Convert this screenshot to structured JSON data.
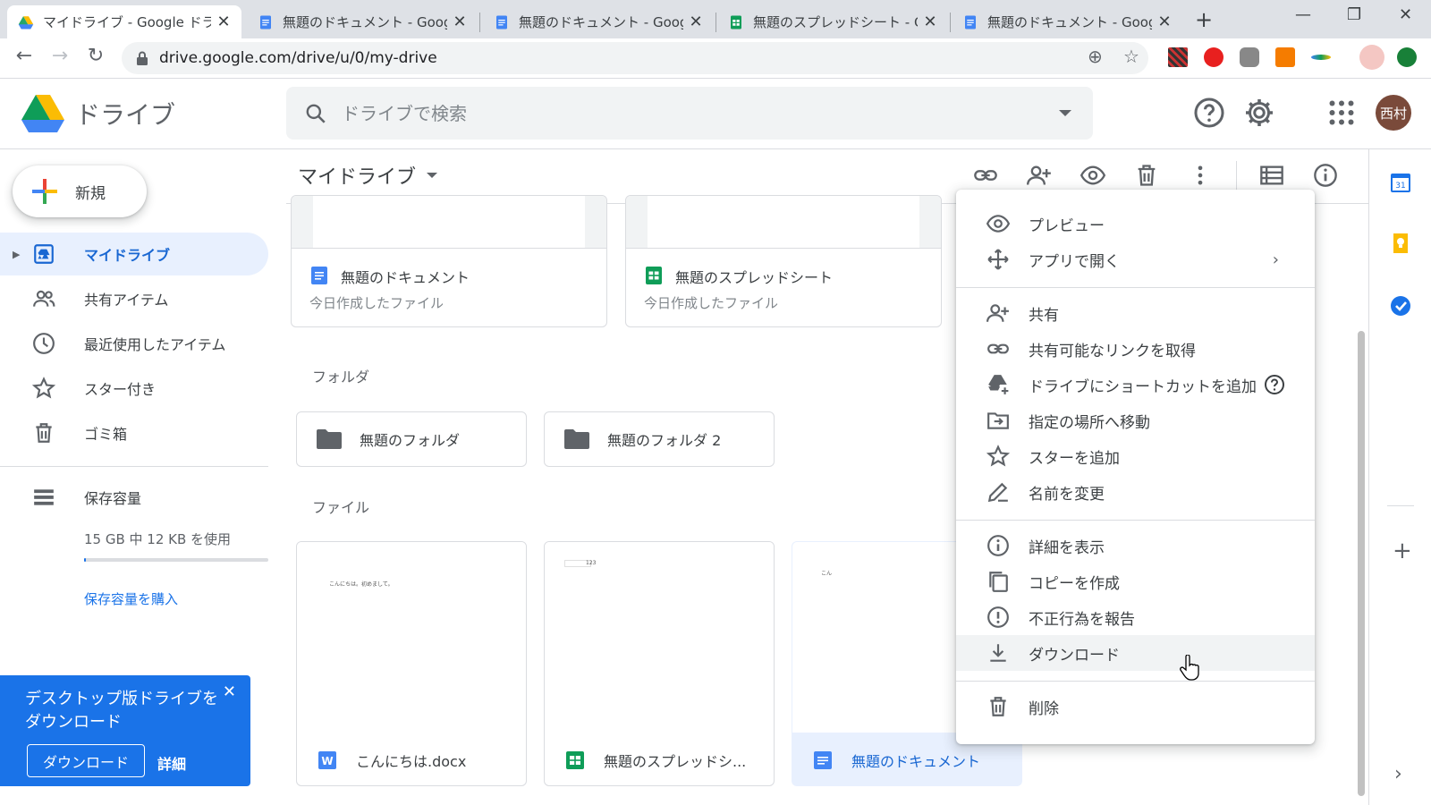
{
  "browser": {
    "tabs": [
      {
        "title": "マイドライブ - Google ドライブ",
        "favicon": "drive-icon",
        "active": true
      },
      {
        "title": "無題のドキュメント - Google ドキュメント",
        "favicon": "docs-icon",
        "active": false
      },
      {
        "title": "無題のドキュメント - Google ドキュメント",
        "favicon": "docs-icon",
        "active": false
      },
      {
        "title": "無題のスプレッドシート - Google スプレッドシート",
        "favicon": "sheets-icon",
        "active": false
      },
      {
        "title": "無題のドキュメント - Google ドキュメント",
        "favicon": "docs-icon",
        "active": false
      }
    ],
    "url": "drive.google.com/drive/u/0/my-drive"
  },
  "header": {
    "brand": "ドライブ",
    "search_placeholder": "ドライブで検索",
    "avatar": "西村"
  },
  "sidebar": {
    "new_label": "新規",
    "items": [
      {
        "label": "マイドライブ",
        "icon": "my-drive-icon",
        "active": true
      },
      {
        "label": "共有アイテム",
        "icon": "shared-icon",
        "active": false
      },
      {
        "label": "最近使用したアイテム",
        "icon": "clock-icon",
        "active": false
      },
      {
        "label": "スター付き",
        "icon": "star-icon",
        "active": false
      },
      {
        "label": "ゴミ箱",
        "icon": "trash-icon",
        "active": false
      }
    ],
    "storage_label": "保存容量",
    "storage_text": "15 GB 中 12 KB を使用",
    "storage_used_fraction": 0.01,
    "buy_storage": "保存容量を購入"
  },
  "promo": {
    "title": "デスクトップ版ドライブをダウンロード",
    "download": "ダウンロード",
    "more": "詳細"
  },
  "main": {
    "breadcrumb": "マイドライブ",
    "quick_access": [
      {
        "name": "無題のドキュメント",
        "subtitle": "今日作成したファイル",
        "type": "docs"
      },
      {
        "name": "無題のスプレッドシート",
        "subtitle": "今日作成したファイル",
        "type": "sheets"
      }
    ],
    "folders_label": "フォルダ",
    "folders": [
      "無題のフォルダ",
      "無題のフォルダ 2"
    ],
    "files_label": "ファイル",
    "files": [
      {
        "name": "こんにちは.docx",
        "type": "word",
        "preview_text": "こんにちは。初めまして。"
      },
      {
        "name": "無題のスプレッドシ...",
        "type": "sheets",
        "preview_text": "123"
      },
      {
        "name": "無題のドキュメント",
        "type": "docs",
        "preview_text": "こん",
        "selected": true
      }
    ]
  },
  "context_menu": {
    "items": [
      {
        "label": "プレビュー",
        "icon": "eye-icon"
      },
      {
        "label": "アプリで開く",
        "icon": "move-arrows-icon",
        "submenu": true
      },
      {
        "label": "共有",
        "icon": "person-add-icon"
      },
      {
        "label": "共有可能なリンクを取得",
        "icon": "link-icon"
      },
      {
        "label": "ドライブにショートカットを追加",
        "icon": "drive-shortcut-icon",
        "help": true
      },
      {
        "label": "指定の場所へ移動",
        "icon": "move-to-icon"
      },
      {
        "label": "スターを追加",
        "icon": "star-outline-icon"
      },
      {
        "label": "名前を変更",
        "icon": "pencil-icon"
      },
      {
        "label": "詳細を表示",
        "icon": "info-icon"
      },
      {
        "label": "コピーを作成",
        "icon": "copy-icon"
      },
      {
        "label": "不正行為を報告",
        "icon": "report-icon"
      },
      {
        "label": "ダウンロード",
        "icon": "download-icon",
        "hover": true
      },
      {
        "label": "削除",
        "icon": "trash-icon"
      }
    ]
  },
  "colors": {
    "accent": "#1a73e8",
    "active_bg": "#e8f0fe",
    "docs_blue": "#4285f4",
    "sheets_green": "#0f9d58"
  }
}
